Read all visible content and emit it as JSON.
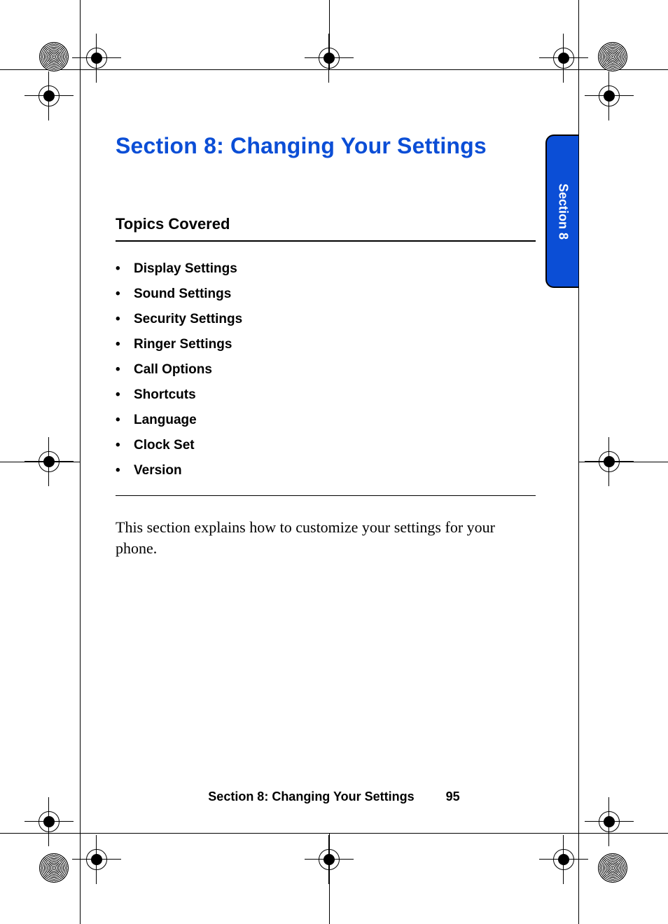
{
  "section": {
    "title": "Section 8: Changing Your Settings"
  },
  "topics": {
    "heading": "Topics Covered",
    "items": [
      "Display Settings",
      "Sound Settings",
      "Security Settings",
      "Ringer Settings",
      "Call Options",
      "Shortcuts",
      "Language",
      "Clock Set",
      "Version"
    ]
  },
  "body": {
    "paragraph": "This section explains how to customize your settings for your phone."
  },
  "side_tab": {
    "label": "Section 8"
  },
  "footer": {
    "title": "Section 8: Changing Your Settings",
    "page": "95"
  }
}
